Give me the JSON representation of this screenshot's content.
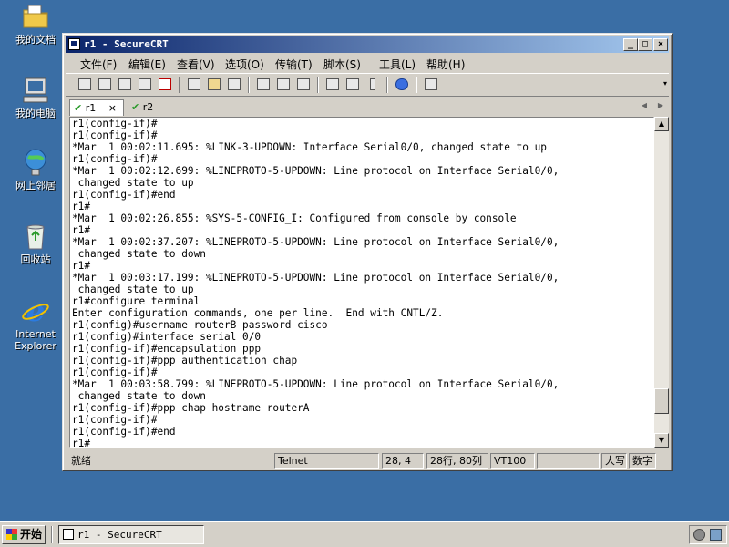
{
  "desktop": {
    "icons": [
      {
        "label": "我的文档",
        "icon": "my-documents-folder-icon"
      },
      {
        "label": "我的电脑",
        "icon": "my-computer-icon"
      },
      {
        "label": "网上邻居",
        "icon": "network-places-icon"
      },
      {
        "label": "回收站",
        "icon": "recycle-bin-icon"
      },
      {
        "label": "Internet\nExplorer",
        "icon": "internet-explorer-icon"
      }
    ]
  },
  "window": {
    "title": "r1 - SecureCRT",
    "controls": {
      "minimize": "_",
      "maximize": "□",
      "close": "×"
    },
    "menu": [
      "文件(F)",
      "编辑(E)",
      "查看(V)",
      "选项(O)",
      "传输(T)",
      "脚本(S)",
      "工具(L)",
      "帮助(H)"
    ],
    "toolbar": [
      "connect",
      "quick-connect",
      "connect-in-tab",
      "reconnect",
      "disconnect",
      "copy",
      "paste",
      "find",
      "print",
      "print-selection",
      "print-setup",
      "session-options",
      "global-options",
      "keymap",
      "help",
      "about"
    ],
    "tabs": [
      {
        "label": "r1",
        "active": true,
        "connected": true,
        "close": "×"
      },
      {
        "label": "r2",
        "active": false,
        "connected": true
      }
    ],
    "tab_nav": {
      "prev": "◀",
      "next": "▶"
    },
    "terminal_lines": [
      "r1(config-if)#",
      "r1(config-if)#",
      "*Mar  1 00:02:11.695: %LINK-3-UPDOWN: Interface Serial0/0, changed state to up",
      "r1(config-if)#",
      "*Mar  1 00:02:12.699: %LINEPROTO-5-UPDOWN: Line protocol on Interface Serial0/0,",
      " changed state to up",
      "r1(config-if)#end",
      "r1#",
      "*Mar  1 00:02:26.855: %SYS-5-CONFIG_I: Configured from console by console",
      "r1#",
      "*Mar  1 00:02:37.207: %LINEPROTO-5-UPDOWN: Line protocol on Interface Serial0/0,",
      " changed state to down",
      "r1#",
      "*Mar  1 00:03:17.199: %LINEPROTO-5-UPDOWN: Line protocol on Interface Serial0/0,",
      " changed state to up",
      "r1#configure terminal",
      "Enter configuration commands, one per line.  End with CNTL/Z.",
      "r1(config)#username routerB password cisco",
      "r1(config)#interface serial 0/0",
      "r1(config-if)#encapsulation ppp",
      "r1(config-if)#ppp authentication chap",
      "r1(config-if)#",
      "*Mar  1 00:03:58.799: %LINEPROTO-5-UPDOWN: Line protocol on Interface Serial0/0,",
      " changed state to down",
      "r1(config-if)#ppp chap hostname routerA",
      "r1(config-if)#",
      "r1(config-if)#end",
      "r1#"
    ],
    "scrollbar": {
      "up": "▲",
      "down": "▼",
      "position": 0.93
    },
    "status": {
      "ready": "就绪",
      "protocol": "Telnet",
      "cursor": "28,  4",
      "size": "28行, 80列",
      "emulation": "VT100",
      "empty": "",
      "caps": "大写",
      "num": "数字"
    }
  },
  "taskbar": {
    "start": "开始",
    "task": "r1 - SecureCRT"
  }
}
